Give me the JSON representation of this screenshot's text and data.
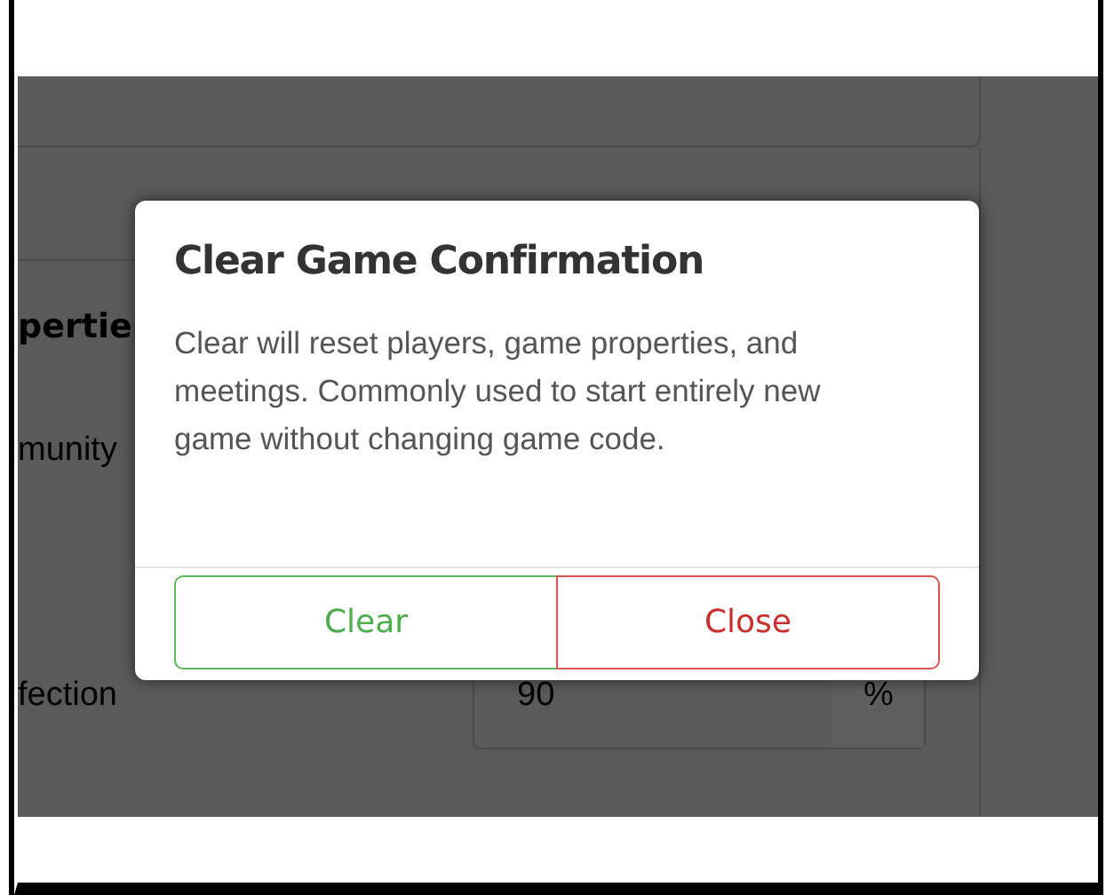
{
  "background": {
    "section_heading": "pertie",
    "labels": [
      {
        "text": "munity"
      },
      {
        "text": "fection",
        "value": "90",
        "unit": "%"
      }
    ]
  },
  "dialog": {
    "title": "Clear Game Confirmation",
    "message": "Clear will reset players, game properties, and meetings. Commonly used to start entirely new game without changing game code.",
    "buttons": [
      {
        "label": "Clear",
        "kind": "confirm"
      },
      {
        "label": "Close",
        "kind": "cancel"
      }
    ]
  }
}
